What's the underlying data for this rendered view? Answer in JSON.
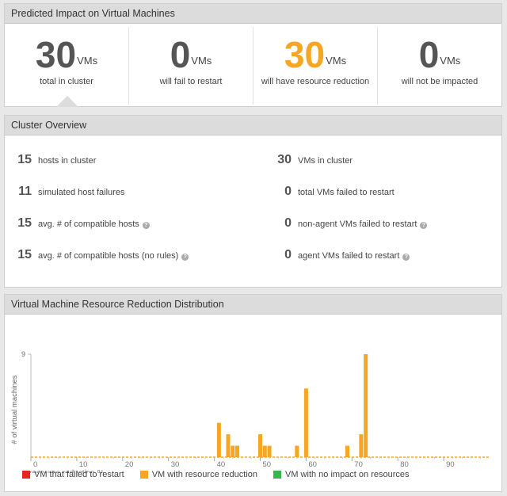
{
  "impact": {
    "title": "Predicted Impact on Virtual Machines",
    "metrics": [
      {
        "value": "30",
        "unit": "VMs",
        "caption": "total in cluster",
        "color": "#555555"
      },
      {
        "value": "0",
        "unit": "VMs",
        "caption": "will fail to restart",
        "color": "#555555"
      },
      {
        "value": "30",
        "unit": "VMs",
        "caption": "will have resource reduction",
        "color": "#f5a623"
      },
      {
        "value": "0",
        "unit": "VMs",
        "caption": "will not be impacted",
        "color": "#555555"
      }
    ]
  },
  "overview": {
    "title": "Cluster Overview",
    "left": [
      {
        "value": "15",
        "label": "hosts in cluster",
        "help": false
      },
      {
        "value": "11",
        "label": "simulated host failures",
        "help": false
      },
      {
        "value": "15",
        "label": "avg. # of compatible hosts",
        "help": true
      },
      {
        "value": "15",
        "label": "avg. # of compatible hosts (no rules)",
        "help": true
      }
    ],
    "right": [
      {
        "value": "30",
        "label": "VMs in cluster",
        "help": false
      },
      {
        "value": "0",
        "label": "total VMs failed to restart",
        "help": false
      },
      {
        "value": "0",
        "label": "non-agent VMs failed to restart",
        "help": true
      },
      {
        "value": "0",
        "label": "agent VMs failed to restart",
        "help": true
      }
    ]
  },
  "distribution": {
    "title": "Virtual Machine Resource Reduction Distribution",
    "legend": [
      {
        "label": "VM that failed to restart",
        "color": "#e8261f"
      },
      {
        "label": "VM with resource reduction",
        "color": "#f5a623"
      },
      {
        "label": "VM with no impact on resources",
        "color": "#3bb54a"
      }
    ]
  },
  "chart_data": {
    "type": "bar",
    "xlabel": "resource reduction %",
    "ylabel": "# of virtual machines",
    "xlim": [
      0,
      100
    ],
    "ylim": [
      0,
      9
    ],
    "xticks": [
      "0",
      "10",
      "20",
      "30",
      "40",
      "50",
      "60",
      "70",
      "80",
      "90"
    ],
    "yticks": [
      "9"
    ],
    "series": [
      {
        "name": "VM with resource reduction",
        "color": "#f5a623",
        "x": [
          41,
          43,
          44,
          45,
          50,
          51,
          52,
          58,
          60,
          69,
          72,
          73
        ],
        "values": [
          3,
          2,
          1,
          1,
          2,
          1,
          1,
          1,
          6,
          1,
          2,
          9
        ]
      }
    ]
  }
}
